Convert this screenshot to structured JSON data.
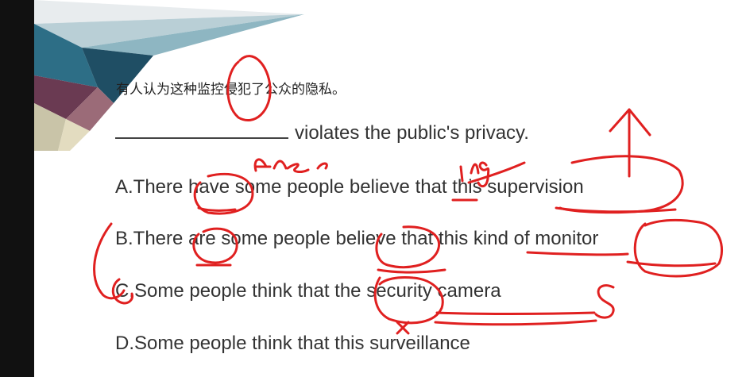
{
  "question": {
    "chinese": "有人认为这种监控侵犯了公众的隐私。",
    "sentence_rest": "violates the public's privacy."
  },
  "options": [
    {
      "text": "A.There have some people believe that this supervision"
    },
    {
      "text": "B.There are some people believe that this kind of monitor"
    },
    {
      "text": "C.Some people think that the security camera"
    },
    {
      "text": "D.Some people think that this surveillance"
    }
  ],
  "colors": {
    "ink": "#e02020",
    "text": "#333333",
    "side_bar": "#111111"
  }
}
